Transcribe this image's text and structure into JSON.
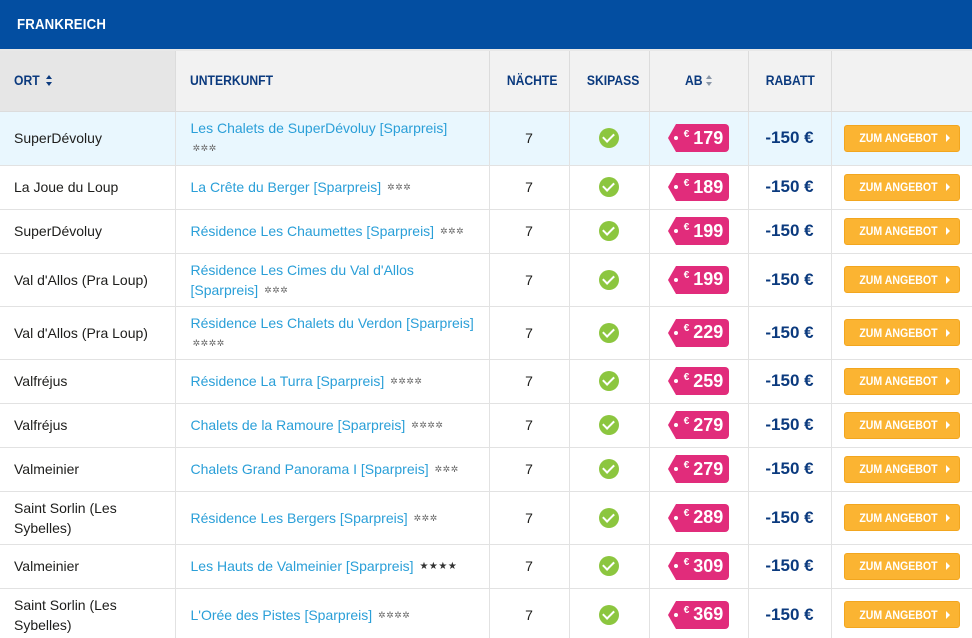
{
  "region": {
    "title": "FRANKREICH"
  },
  "headers": {
    "ort": "ORT",
    "unterkunft": "UNTERKUNFT",
    "naechte": "NÄCHTE",
    "skipass": "SKIPASS",
    "ab": "AB",
    "rabatt": "RABATT"
  },
  "colors": {
    "brand_blue": "#034ea1",
    "price_pink": "#e12c7b",
    "button_orange": "#fbb432",
    "check_green": "#8cc63f",
    "link_blue": "#2a9fd8"
  },
  "rows": [
    {
      "ort": "SuperDévoluy",
      "unterkunft": "Les Chalets de SuperDévoluy [Sparpreis]",
      "stars": "✲✲✲",
      "naechte": "7",
      "skipass": "check-icon",
      "currency": "€",
      "preis": "179",
      "rabatt": "-150 €",
      "button": "ZUM ANGEBOT"
    },
    {
      "ort": "La Joue du Loup",
      "unterkunft": "La Crête du Berger [Sparpreis]",
      "stars": "✲✲✲",
      "naechte": "7",
      "skipass": "check-icon",
      "currency": "€",
      "preis": "189",
      "rabatt": "-150 €",
      "button": "ZUM ANGEBOT"
    },
    {
      "ort": "SuperDévoluy",
      "unterkunft": "Résidence Les Chaumettes [Sparpreis]",
      "stars": "✲✲✲",
      "naechte": "7",
      "skipass": "check-icon",
      "currency": "€",
      "preis": "199",
      "rabatt": "-150 €",
      "button": "ZUM ANGEBOT"
    },
    {
      "ort": "Val d'Allos (Pra Loup)",
      "unterkunft": "Résidence Les Cimes du Val d'Allos [Sparpreis]",
      "stars": "✲✲✲",
      "naechte": "7",
      "skipass": "check-icon",
      "currency": "€",
      "preis": "199",
      "rabatt": "-150 €",
      "button": "ZUM ANGEBOT"
    },
    {
      "ort": "Val d'Allos (Pra Loup)",
      "unterkunft": "Résidence Les Chalets du Verdon [Sparpreis]",
      "stars": "✲✲✲✲",
      "naechte": "7",
      "skipass": "check-icon",
      "currency": "€",
      "preis": "229",
      "rabatt": "-150 €",
      "button": "ZUM ANGEBOT"
    },
    {
      "ort": "Valfréjus",
      "unterkunft": "Résidence La Turra [Sparpreis]",
      "stars": "✲✲✲✲",
      "naechte": "7",
      "skipass": "check-icon",
      "currency": "€",
      "preis": "259",
      "rabatt": "-150 €",
      "button": "ZUM ANGEBOT"
    },
    {
      "ort": "Valfréjus",
      "unterkunft": "Chalets de la Ramoure [Sparpreis]",
      "stars": "✲✲✲✲",
      "naechte": "7",
      "skipass": "check-icon",
      "currency": "€",
      "preis": "279",
      "rabatt": "-150 €",
      "button": "ZUM ANGEBOT"
    },
    {
      "ort": "Valmeinier",
      "unterkunft": "Chalets Grand Panorama I [Sparpreis]",
      "stars": "✲✲✲",
      "naechte": "7",
      "skipass": "check-icon",
      "currency": "€",
      "preis": "279",
      "rabatt": "-150 €",
      "button": "ZUM ANGEBOT"
    },
    {
      "ort": "Saint Sorlin (Les Sybelles)",
      "unterkunft": "Résidence Les Bergers [Sparpreis]",
      "stars": "✲✲✲",
      "naechte": "7",
      "skipass": "check-icon",
      "currency": "€",
      "preis": "289",
      "rabatt": "-150 €",
      "button": "ZUM ANGEBOT"
    },
    {
      "ort": "Valmeinier",
      "unterkunft": "Les Hauts de Valmeinier [Sparpreis]",
      "stars": "★★★★",
      "naechte": "7",
      "skipass": "check-icon",
      "currency": "€",
      "preis": "309",
      "rabatt": "-150 €",
      "button": "ZUM ANGEBOT"
    },
    {
      "ort": "Saint Sorlin (Les Sybelles)",
      "unterkunft": "L'Orée des Pistes [Sparpreis]",
      "stars": "✲✲✲✲",
      "naechte": "7",
      "skipass": "check-icon",
      "currency": "€",
      "preis": "369",
      "rabatt": "-150 €",
      "button": "ZUM ANGEBOT"
    }
  ]
}
